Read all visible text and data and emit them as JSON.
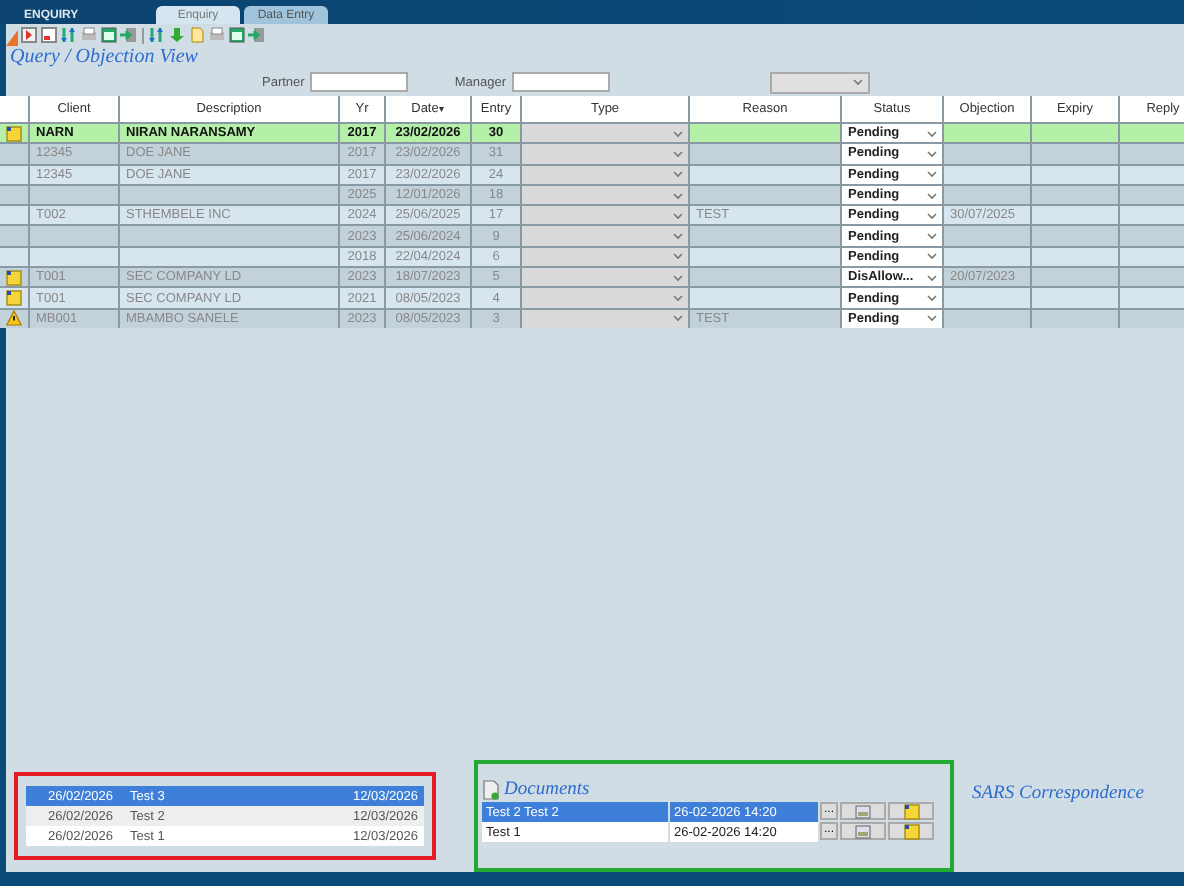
{
  "window": {
    "title": "ENQUIRY"
  },
  "tabs": [
    {
      "label": "Enquiry",
      "selected": true
    },
    {
      "label": "Data Entry",
      "selected": false
    }
  ],
  "view_title": "Query / Objection View",
  "filters": {
    "partner_label": "Partner",
    "manager_label": "Manager"
  },
  "table": {
    "columns": [
      "Client",
      "Description",
      "Yr",
      "Date",
      "Entry",
      "Type",
      "Reason",
      "Status",
      "Objection",
      "Expiry",
      "Reply"
    ],
    "sort_mark": "▾",
    "rows": [
      {
        "kind": "note",
        "selected": true,
        "client": "NARN",
        "description": "NIRAN NARANSAMY",
        "yr": "2017",
        "date": "23/02/2026",
        "entry": "30",
        "reason": "",
        "status": "Pending",
        "objection": ""
      },
      {
        "kind": "plain",
        "selected": false,
        "client": "12345",
        "description": "DOE JANE",
        "yr": "2017",
        "date": "23/02/2026",
        "entry": "31",
        "reason": "",
        "status": "Pending",
        "objection": ""
      },
      {
        "kind": "plain",
        "selected": false,
        "client": "12345",
        "description": "DOE JANE",
        "yr": "2017",
        "date": "23/02/2026",
        "entry": "24",
        "reason": "",
        "status": "Pending",
        "objection": ""
      },
      {
        "kind": "plain",
        "selected": false,
        "client": "",
        "description": "",
        "yr": "2025",
        "date": "12/01/2026",
        "entry": "18",
        "reason": "",
        "status": "Pending",
        "objection": ""
      },
      {
        "kind": "plain",
        "selected": false,
        "client": "T002",
        "description": "STHEMBELE INC",
        "yr": "2024",
        "date": "25/06/2025",
        "entry": "17",
        "reason": "TEST",
        "status": "Pending",
        "objection": "30/07/2025"
      },
      {
        "kind": "plain",
        "selected": false,
        "client": "",
        "description": "",
        "yr": "2023",
        "date": "25/06/2024",
        "entry": "9",
        "reason": "",
        "status": "Pending",
        "objection": ""
      },
      {
        "kind": "plain",
        "selected": false,
        "client": "",
        "description": "",
        "yr": "2018",
        "date": "22/04/2024",
        "entry": "6",
        "reason": "",
        "status": "Pending",
        "objection": ""
      },
      {
        "kind": "note",
        "selected": false,
        "client": "T001",
        "description": "SEC COMPANY LD",
        "yr": "2023",
        "date": "18/07/2023",
        "entry": "5",
        "reason": "",
        "status": "DisAllow...",
        "objection": "20/07/2023"
      },
      {
        "kind": "note",
        "selected": false,
        "client": "T001",
        "description": "SEC COMPANY LD",
        "yr": "2021",
        "date": "08/05/2023",
        "entry": "4",
        "reason": "",
        "status": "Pending",
        "objection": ""
      },
      {
        "kind": "warning",
        "selected": false,
        "client": "MB001",
        "description": "MBAMBO SANELE",
        "yr": "2023",
        "date": "08/05/2023",
        "entry": "3",
        "reason": "TEST",
        "status": "Pending",
        "objection": ""
      }
    ]
  },
  "notes": [
    {
      "date": "26/02/2026",
      "text": "Test 3",
      "due": "12/03/2026",
      "selected": true
    },
    {
      "date": "26/02/2026",
      "text": "Test 2",
      "due": "12/03/2026",
      "selected": false
    },
    {
      "date": "26/02/2026",
      "text": "Test 1",
      "due": "12/03/2026",
      "selected": false
    }
  ],
  "documents": {
    "title": "Documents",
    "rows": [
      {
        "name": "Test 2 Test 2",
        "datetime": "26-02-2026 14:20",
        "browse": "...",
        "selected": true
      },
      {
        "name": "Test 1",
        "datetime": "26-02-2026 14:20",
        "browse": "...",
        "selected": false
      }
    ]
  },
  "correspondence_title": "SARS Correspondence"
}
